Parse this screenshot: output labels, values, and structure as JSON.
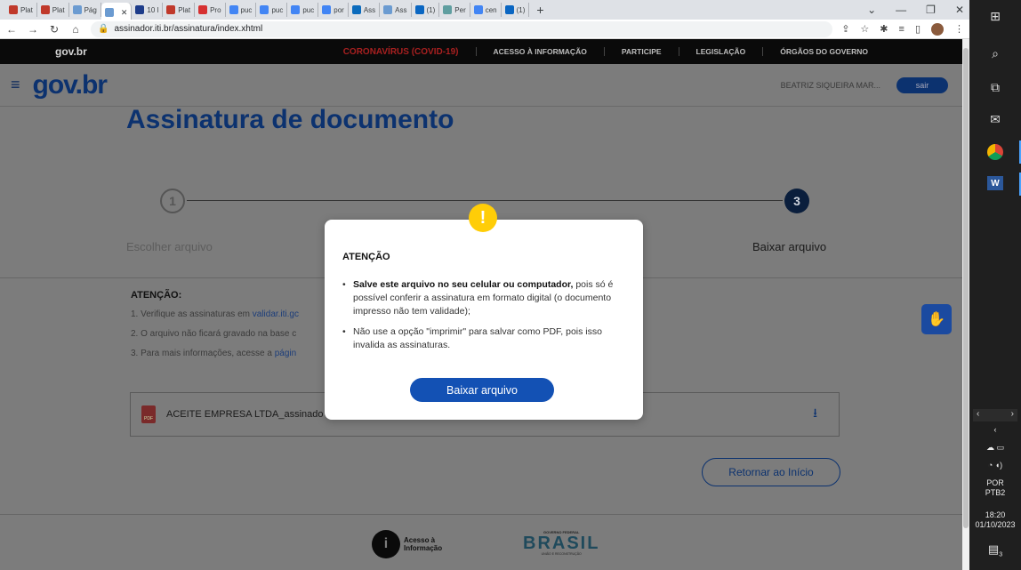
{
  "browser": {
    "tabs": [
      {
        "label": "Plat",
        "color": "#c0392b"
      },
      {
        "label": "Plat",
        "color": "#c0392b"
      },
      {
        "label": "Pág",
        "color": "#6b9bd1"
      },
      {
        "label": "",
        "color": "#6b9bd1",
        "active": true
      },
      {
        "label": "10 l",
        "color": "#1d3c8a"
      },
      {
        "label": "Plat",
        "color": "#c0392b"
      },
      {
        "label": "Pro",
        "color": "#d63031"
      },
      {
        "label": "puc",
        "color": "#4285f4"
      },
      {
        "label": "puc",
        "color": "#4285f4"
      },
      {
        "label": "puc",
        "color": "#4285f4"
      },
      {
        "label": "por",
        "color": "#4285f4"
      },
      {
        "label": "Ass",
        "color": "#0b6bbd"
      },
      {
        "label": "Ass",
        "color": "#6b9bd1"
      },
      {
        "label": "(1)",
        "color": "#0a66c2"
      },
      {
        "label": "Per",
        "color": "#5f9ea0"
      },
      {
        "label": "cen",
        "color": "#4285f4"
      },
      {
        "label": "(1)",
        "color": "#0a66c2"
      }
    ],
    "url": "assinador.iti.br/assinatura/index.xhtml"
  },
  "gov_bar": {
    "logo": "gov.br",
    "links": [
      "CORONAVÍRUS (COVID-19)",
      "ACESSO À INFORMAÇÃO",
      "PARTICIPE",
      "LEGISLAÇÃO",
      "ÓRGÃOS DO GOVERNO"
    ]
  },
  "header": {
    "logo": "gov.br",
    "user": "BEATRIZ SIQUEIRA MAR...",
    "logout": "sair"
  },
  "page": {
    "title": "Assinatura de documento",
    "steps": [
      {
        "number": "1",
        "label": "Escolher arquivo"
      },
      {
        "number": "3",
        "label": "Baixar arquivo"
      }
    ],
    "attention_title": "ATENÇÃO:",
    "attention_items": [
      {
        "text": "1. Verifique as assinaturas em ",
        "link": "validar.iti.gc"
      },
      {
        "text": "2. O arquivo não ficará gravado na base c",
        "link": ""
      },
      {
        "text": "3. Para mais informações, acesse a ",
        "link": "págin"
      }
    ],
    "file_name": "ACEITE EMPRESA LTDA_assinado",
    "return_button": "Retornar ao Início",
    "footer_acesso": [
      "Acesso à",
      "Informação"
    ],
    "footer_brasil": {
      "top": "GOVERNO FEDERAL",
      "name": "BRASIL",
      "sub": "UNIÃO E RECONSTRUÇÃO"
    }
  },
  "modal": {
    "title": "ATENÇÃO",
    "items": [
      {
        "bold": "Salve este arquivo no seu celular ou computador,",
        "text": " pois só é possível conferir a assinatura em formato digital (o documento impresso não tem validade);"
      },
      {
        "bold": "",
        "text": "Não use a opção \"imprimir\" para salvar como PDF, pois isso invalida as assinaturas."
      }
    ],
    "button": "Baixar arquivo"
  },
  "taskbar": {
    "language": "POR",
    "layout": "PTB2",
    "time": "18:20",
    "date": "01/10/2023",
    "notifications": "3"
  },
  "colors": {
    "gov_blue": "#0c326f",
    "primary": "#1351b4",
    "warning": "#ffcd07"
  }
}
